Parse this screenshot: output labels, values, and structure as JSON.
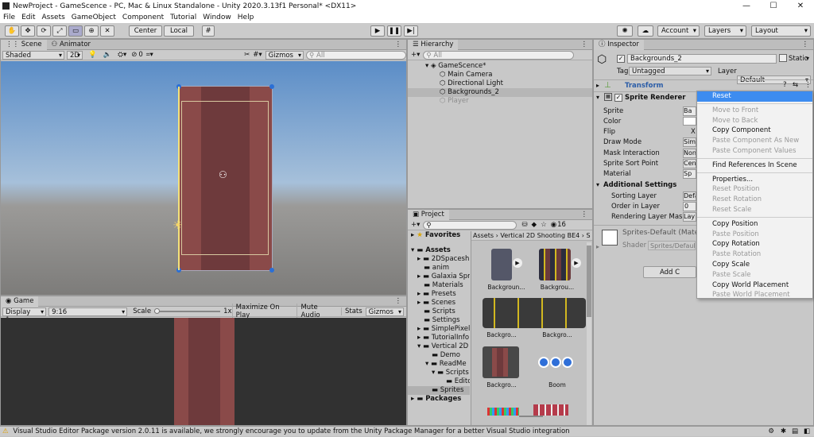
{
  "window": {
    "title": "NewProject - GameScence - PC, Mac & Linux Standalone - Unity 2020.3.13f1 Personal* <DX11>",
    "controls": [
      "—",
      "☐",
      "✕"
    ]
  },
  "menu": [
    "File",
    "Edit",
    "Assets",
    "GameObject",
    "Component",
    "Tutorial",
    "Window",
    "Help"
  ],
  "toolbar": {
    "center_label": "Center",
    "local_label": "Local",
    "account_label": "Account",
    "layers_label": "Layers",
    "layout_label": "Layout"
  },
  "scene": {
    "tabs": [
      "Scene",
      "Animator"
    ],
    "shading": "Shaded",
    "mode_2d": "2D",
    "gizmos": "Gizmos",
    "search_placeholder": "All",
    "layer_count": "0"
  },
  "game": {
    "tab": "Game",
    "display": "Display 1",
    "aspect": "9:16",
    "scale_label": "Scale",
    "scale_value": "1x",
    "maximize": "Maximize On Play",
    "mute": "Mute Audio",
    "stats": "Stats",
    "gizmos": "Gizmos"
  },
  "hierarchy": {
    "tab": "Hierarchy",
    "search_placeholder": "All",
    "scene_name": "GameScence*",
    "items": [
      "Main Camera",
      "Directional Light",
      "Backgrounds_2",
      "Player"
    ]
  },
  "project": {
    "tab": "Project",
    "badge": "16",
    "favorites": "Favorites",
    "assets_root": "Assets",
    "folders": [
      "2DSpacesh",
      "anim",
      "Galaxia Spr",
      "Materials",
      "Presets",
      "Scenes",
      "Scripts",
      "Settings",
      "SimplePixel",
      "TutorialInfo",
      "Vertical 2D"
    ],
    "subfolders": [
      "Demo",
      "ReadMe",
      "Scripts",
      "Edito",
      "Sprites"
    ],
    "packages": "Packages",
    "breadcrumb": [
      "Assets",
      "Vertical 2D Shooting BE4",
      "S"
    ],
    "asset_labels": [
      "Backgroun...",
      "Backgrou...",
      "Backgro...",
      "Backgro...",
      "Boom"
    ]
  },
  "inspector": {
    "tab": "Inspector",
    "object_name": "Backgrounds_2",
    "static_label": "Static",
    "tag_label": "Tag",
    "tag_value": "Untagged",
    "layer_label": "Layer",
    "layer_value": "Default",
    "transform": "Transform",
    "sprite_renderer": "Sprite Renderer",
    "fields": [
      "Sprite",
      "Color",
      "Flip",
      "Draw Mode",
      "Mask Interaction",
      "Sprite Sort Point",
      "Material"
    ],
    "field_values": [
      "Ba",
      "",
      "X",
      "Sim",
      "Non",
      "Cen",
      "Sp"
    ],
    "additional_settings": "Additional Settings",
    "sorting_fields": [
      "Sorting Layer",
      "Order in Layer",
      "Rendering Layer Mask"
    ],
    "sorting_values": [
      "Defa",
      "0",
      "Lay"
    ],
    "material_name": "Sprites-Default (Mater",
    "shader_label": "Shader",
    "shader_value": "Sprites/Default",
    "add_component": "Add C"
  },
  "context_menu": {
    "items": [
      {
        "label": "Reset",
        "state": "selected"
      },
      {
        "sep": true
      },
      {
        "label": "Move to Front",
        "state": "disabled"
      },
      {
        "label": "Move to Back",
        "state": "disabled"
      },
      {
        "label": "Copy Component",
        "state": "enabled"
      },
      {
        "label": "Paste Component As New",
        "state": "disabled"
      },
      {
        "label": "Paste Component Values",
        "state": "disabled"
      },
      {
        "sep": true
      },
      {
        "label": "Find References In Scene",
        "state": "enabled"
      },
      {
        "sep": true
      },
      {
        "label": "Properties...",
        "state": "enabled"
      },
      {
        "label": "Reset Position",
        "state": "disabled"
      },
      {
        "label": "Reset Rotation",
        "state": "disabled"
      },
      {
        "label": "Reset Scale",
        "state": "disabled"
      },
      {
        "sep": true
      },
      {
        "label": "Copy Position",
        "state": "enabled"
      },
      {
        "label": "Paste Position",
        "state": "disabled"
      },
      {
        "label": "Copy Rotation",
        "state": "enabled"
      },
      {
        "label": "Paste Rotation",
        "state": "disabled"
      },
      {
        "label": "Copy Scale",
        "state": "enabled"
      },
      {
        "label": "Paste Scale",
        "state": "disabled"
      },
      {
        "label": "Copy World Placement",
        "state": "enabled"
      },
      {
        "label": "Paste World Placement",
        "state": "disabled"
      }
    ]
  },
  "status": {
    "message": "Visual Studio Editor Package version 2.0.11 is available, we strongly encourage you to update from the Unity Package Manager for a better Visual Studio integration"
  },
  "colors": {
    "accent": "#3d8cf0",
    "background_sprite": "#8a4a49",
    "warning": "#e0a000"
  }
}
